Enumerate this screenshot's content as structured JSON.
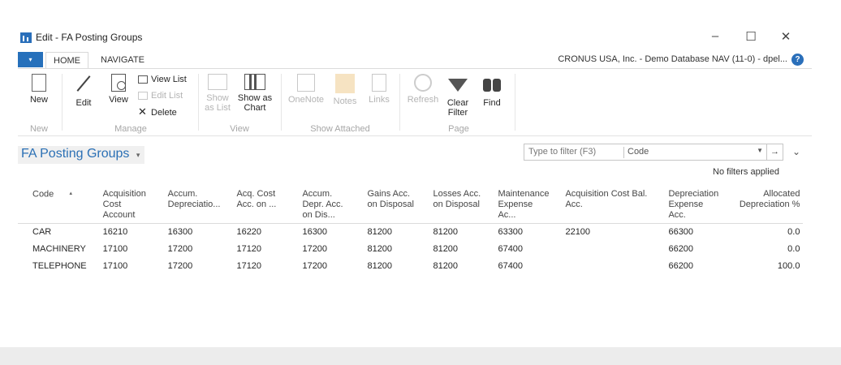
{
  "window": {
    "title": "Edit - FA Posting Groups",
    "minimize": "–",
    "maximize": "☐",
    "close": "✕"
  },
  "ribbon_tabs": {
    "file": "▾",
    "home": "HOME",
    "navigate": "NAVIGATE",
    "company": "CRONUS USA, Inc. - Demo Database NAV (11-0) - dpel...",
    "help": "?"
  },
  "ribbon": {
    "new": "New",
    "edit": "Edit",
    "view": "View",
    "view_list": "View List",
    "edit_list": "Edit List",
    "delete": "Delete",
    "show_as_list_1": "Show",
    "show_as_list_2": "as List",
    "show_as_chart_1": "Show as",
    "show_as_chart_2": "Chart",
    "onenote": "OneNote",
    "notes": "Notes",
    "links": "Links",
    "refresh": "Refresh",
    "clear_filter_1": "Clear",
    "clear_filter_2": "Filter",
    "find": "Find",
    "groups": {
      "new": "New",
      "manage": "Manage",
      "view": "View",
      "show_attached": "Show Attached",
      "page": "Page"
    }
  },
  "page": {
    "title": "FA Posting Groups",
    "title_chevron": "▾",
    "filter_placeholder": "Type to filter (F3)",
    "filter_field": "Code",
    "filter_dropdown": "▼",
    "filter_go": "→",
    "expand_chevron": "⌄",
    "no_filters": "No filters applied"
  },
  "table": {
    "columns": [
      "Code",
      "Acquisition Cost Account",
      "Accum. Depreciatio...",
      "Acq. Cost Acc. on ...",
      "Accum. Depr. Acc. on Dis...",
      "Gains Acc. on Disposal",
      "Losses Acc. on Disposal",
      "Maintenance Expense Ac...",
      "Acquisition Cost Bal. Acc.",
      "Depreciation Expense Acc.",
      "Allocated Depreciation %"
    ],
    "rows": [
      [
        "CAR",
        "16210",
        "16300",
        "16220",
        "16300",
        "81200",
        "81200",
        "63300",
        "22100",
        "66300",
        "0.0"
      ],
      [
        "MACHINERY",
        "17100",
        "17200",
        "17120",
        "17200",
        "81200",
        "81200",
        "67400",
        "",
        "66200",
        "0.0"
      ],
      [
        "TELEPHONE",
        "17100",
        "17200",
        "17120",
        "17200",
        "81200",
        "81200",
        "67400",
        "",
        "66200",
        "100.0"
      ]
    ]
  }
}
